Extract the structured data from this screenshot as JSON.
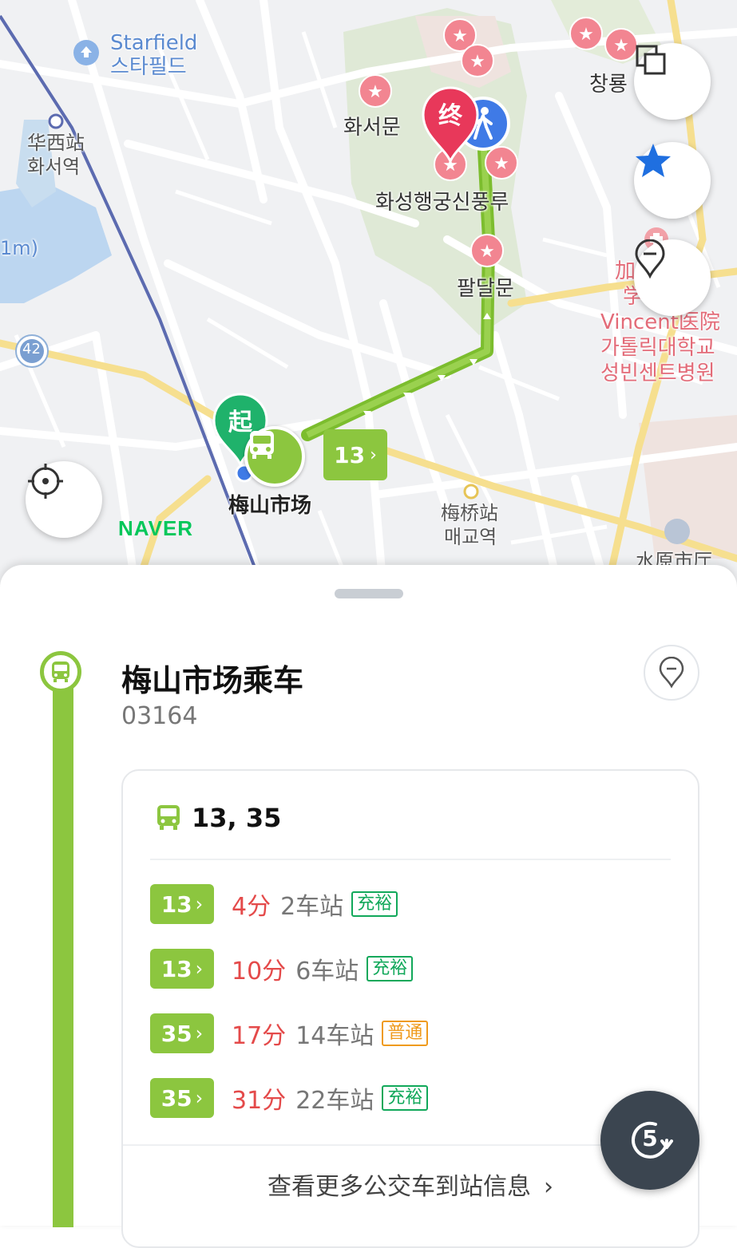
{
  "map": {
    "place_labels": {
      "starfield_en": "Starfield",
      "starfield_ko": "스타필드",
      "hwaseo_station_zh": "华西站",
      "hwaseo_station_ko": "화서역",
      "hwaseomun": "화서문",
      "changnyong": "창룡",
      "haenggung": "화성행궁신풍루",
      "paldalmun": "팔달문",
      "hospital_1": "加",
      "hospital_2": "学",
      "hospital_3": "Vincent医院",
      "hospital_4": "가톨릭대학교",
      "hospital_5": "성빈센트병원",
      "maesan_market": "梅山市场",
      "maegyo_zh": "梅桥站",
      "maegyo_ko": "매교역",
      "suwon_city": "水原市厅",
      "road_number": "42",
      "edge_label": "1m)"
    },
    "start_marker": "起",
    "end_marker": "终",
    "route_badge": "13",
    "naver_logo": "NAVER"
  },
  "sheet": {
    "stop_name": "梅山市场乘车",
    "stop_code": "03164",
    "routes_summary": "13, 35",
    "arrivals": [
      {
        "route": "13",
        "minutes": "4分",
        "stops": "2车站",
        "status": "充裕",
        "status_color": "#11a85a"
      },
      {
        "route": "13",
        "minutes": "10分",
        "stops": "6车站",
        "status": "充裕",
        "status_color": "#11a85a"
      },
      {
        "route": "35",
        "minutes": "17分",
        "stops": "14车站",
        "status": "普通",
        "status_color": "#ef9a1c"
      },
      {
        "route": "35",
        "minutes": "31分",
        "stops": "22车站",
        "status": "充裕",
        "status_color": "#11a85a"
      }
    ],
    "more_link": "查看更多公交车到站信息",
    "refresh_count": "5"
  },
  "colors": {
    "accent": "#8cc63f",
    "minutes": "#e44a4a",
    "map_bg": "#f1f2f4",
    "fab_dark": "#3b4550"
  },
  "icons": [
    "layers-icon",
    "star-icon",
    "location-pin-icon",
    "gps-locate-icon",
    "bus-icon",
    "walk-icon",
    "refresh-icon",
    "chevron-right-icon"
  ]
}
